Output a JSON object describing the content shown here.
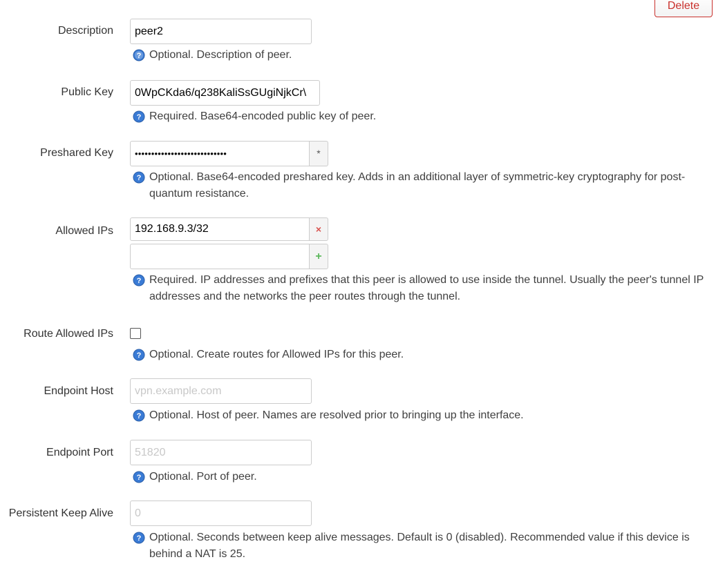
{
  "delete_label": "Delete",
  "fields": {
    "description": {
      "label": "Description",
      "value": "peer2",
      "help": "Optional. Description of peer."
    },
    "public_key": {
      "label": "Public Key",
      "value": "0WpCKda6/q238KaliSsGUgiNjkCr\\",
      "help": "Required. Base64-encoded public key of peer."
    },
    "preshared_key": {
      "label": "Preshared Key",
      "masked_value": "••••••••••••••••••••••••••••",
      "reveal_glyph": "*",
      "help": "Optional. Base64-encoded preshared key. Adds in an additional layer of symmetric-key cryptography for post-quantum resistance."
    },
    "allowed_ips": {
      "label": "Allowed IPs",
      "items": [
        "192.168.9.3/32"
      ],
      "new_value": "",
      "remove_glyph": "×",
      "add_glyph": "+",
      "help": "Required. IP addresses and prefixes that this peer is allowed to use inside the tunnel. Usually the peer's tunnel IP addresses and the networks the peer routes through the tunnel."
    },
    "route_allowed_ips": {
      "label": "Route Allowed IPs",
      "checked": false,
      "help": "Optional. Create routes for Allowed IPs for this peer."
    },
    "endpoint_host": {
      "label": "Endpoint Host",
      "placeholder": "vpn.example.com",
      "help": "Optional. Host of peer. Names are resolved prior to bringing up the interface."
    },
    "endpoint_port": {
      "label": "Endpoint Port",
      "placeholder": "51820",
      "help": "Optional. Port of peer."
    },
    "persistent_keep_alive": {
      "label": "Persistent Keep Alive",
      "placeholder": "0",
      "help": "Optional. Seconds between keep alive messages. Default is 0 (disabled). Recommended value if this device is behind a NAT is 25."
    }
  },
  "colors": {
    "help_icon": "#3a7bd5",
    "delete_accent": "#c9302c",
    "remove_accent": "#d9534f",
    "add_accent": "#5cb85c"
  },
  "icons": {
    "help": "help-icon"
  }
}
